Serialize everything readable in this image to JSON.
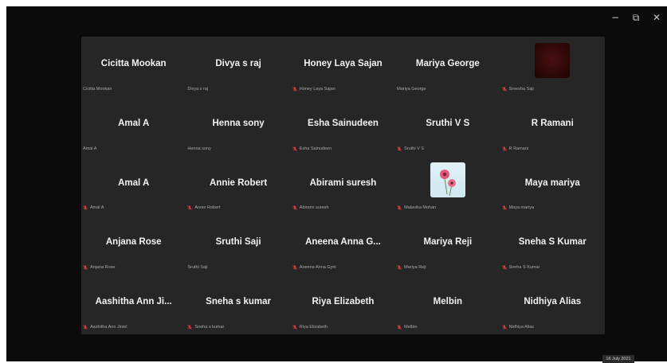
{
  "window": {
    "controls": {
      "minimize": "−",
      "restore": "⧉",
      "close": "✕"
    }
  },
  "participants": [
    {
      "name": "Cicitta Mookan",
      "label": "Cicitta Mookan",
      "muted": false
    },
    {
      "name": "Divya s raj",
      "label": "Divya s raj",
      "muted": false
    },
    {
      "name": "Honey Laya Sajan",
      "label": "Honey Laya Sajan",
      "muted": true
    },
    {
      "name": "Mariya George",
      "label": "Mariya George",
      "muted": false
    },
    {
      "name": "",
      "label": "Sreesha Saji",
      "muted": true,
      "video": "dark"
    },
    {
      "name": "Amal A",
      "label": "Amal A",
      "muted": false
    },
    {
      "name": "Henna sony",
      "label": "Henna sony",
      "muted": false
    },
    {
      "name": "Esha Sainudeen",
      "label": "Esha Sainudeen",
      "muted": true
    },
    {
      "name": "Sruthi V S",
      "label": "Sruthi V S",
      "muted": true
    },
    {
      "name": "R Ramani",
      "label": "R Ramani",
      "muted": true
    },
    {
      "name": "Amal A",
      "label": "Amal A",
      "muted": true
    },
    {
      "name": "Annie Robert",
      "label": "Annie Robert",
      "muted": true
    },
    {
      "name": "Abirami suresh",
      "label": "Abirami suresh",
      "muted": true
    },
    {
      "name": "",
      "label": "Malavika Mohan",
      "muted": true,
      "video": "flower"
    },
    {
      "name": "Maya mariya",
      "label": "Maya mariya",
      "muted": true
    },
    {
      "name": "Anjana Rose",
      "label": "Anjana Rose",
      "muted": true
    },
    {
      "name": "Sruthi Saji",
      "label": "Sruthi Saji",
      "muted": false
    },
    {
      "name": "Aneena Anna G...",
      "label": "Aneena Anna Gyni",
      "muted": true
    },
    {
      "name": "Mariya Reji",
      "label": "Mariya Reji",
      "muted": true
    },
    {
      "name": "Sneha S Kumar",
      "label": "Sneha S Kumar",
      "muted": true
    },
    {
      "name": "Aashitha Ann Ji...",
      "label": "Aashitha Ann Jiniel",
      "muted": true
    },
    {
      "name": "Sneha s kumar",
      "label": "Sneha s kumar",
      "muted": true
    },
    {
      "name": "Riya Elizabeth",
      "label": "Riya Elizabeth",
      "muted": true
    },
    {
      "name": "Melbin",
      "label": "Melbin",
      "muted": true
    },
    {
      "name": "Nidhiya Alias",
      "label": "Nidhiya Alias",
      "muted": true
    }
  ],
  "date": "16 July 2021",
  "colors": {
    "mute": "#e23b3b",
    "panel": "#262626",
    "background": "#0b0b0b"
  }
}
